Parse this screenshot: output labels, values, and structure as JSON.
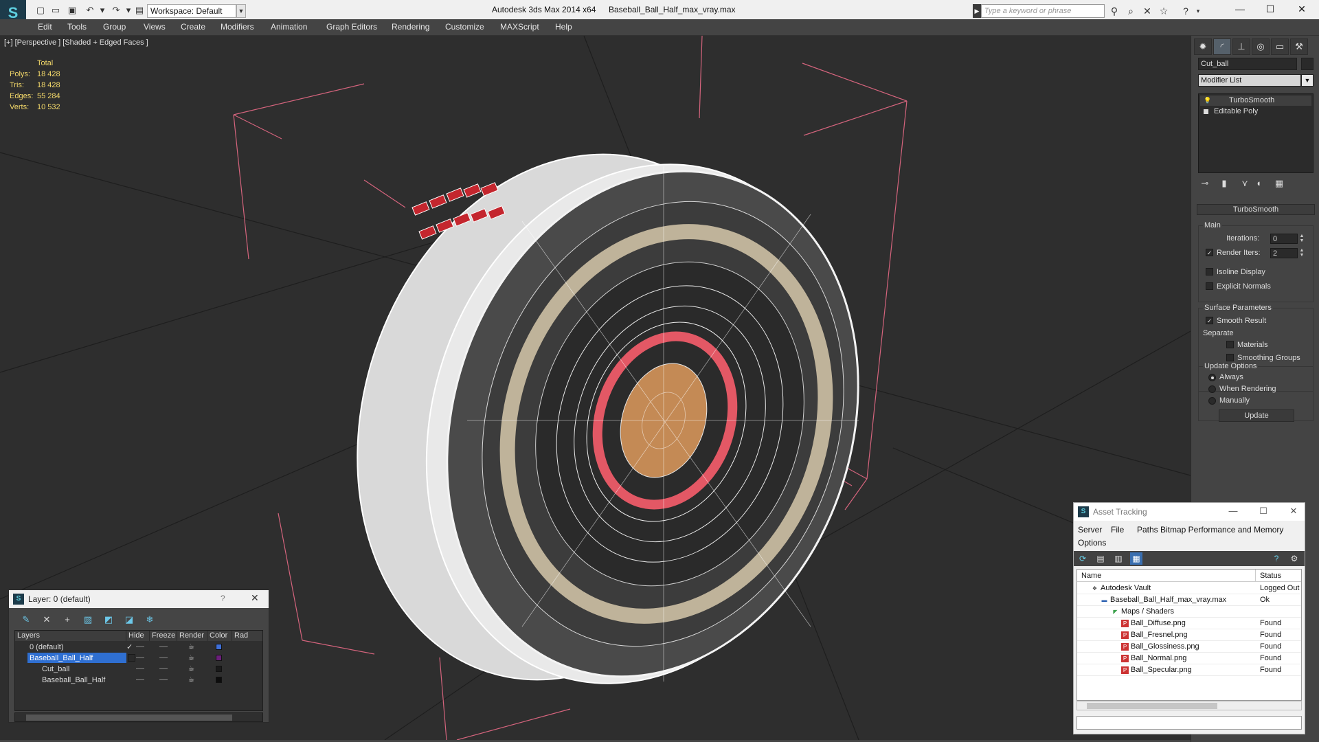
{
  "titlebar": {
    "app_title": "Autodesk 3ds Max  2014 x64",
    "file_title": "Baseball_Ball_Half_max_vray.max",
    "workspace": "Workspace: Default",
    "search_placeholder": "Type a keyword or phrase"
  },
  "menu": [
    "Edit",
    "Tools",
    "Group",
    "Views",
    "Create",
    "Modifiers",
    "Animation",
    "Graph Editors",
    "Rendering",
    "Customize",
    "MAXScript",
    "Help"
  ],
  "viewport": {
    "label": "[+] [Perspective ] [Shaded + Edged Faces ]",
    "stats": {
      "header": "Total",
      "polys_label": "Polys:",
      "polys": "18 428",
      "tris_label": "Tris:",
      "tris": "18 428",
      "edges_label": "Edges:",
      "edges": "55 284",
      "verts_label": "Verts:",
      "verts": "10 532"
    }
  },
  "command_panel": {
    "object_name": "Cut_ball",
    "modifier_list": "Modifier List",
    "stack": [
      "TurboSmooth",
      "Editable Poly"
    ],
    "rollout_title": "TurboSmooth",
    "main_group": "Main",
    "iterations_label": "Iterations:",
    "iterations_value": "0",
    "render_iters_label": "Render Iters:",
    "render_iters_value": "2",
    "isoline_label": "Isoline Display",
    "explicit_normals_label": "Explicit Normals",
    "surface_group": "Surface Parameters",
    "smooth_result_label": "Smooth Result",
    "separate_label": "Separate",
    "materials_label": "Materials",
    "smoothing_groups_label": "Smoothing Groups",
    "update_group": "Update Options",
    "always_label": "Always",
    "when_rendering_label": "When Rendering",
    "manually_label": "Manually",
    "update_button": "Update"
  },
  "layer_dialog": {
    "title": "Layer: 0 (default)",
    "help": "?",
    "columns": [
      "Layers",
      "Hide",
      "Freeze",
      "Render",
      "Color",
      "Rad"
    ],
    "rows": [
      {
        "name": "0 (default)",
        "color": "#3f6fd8"
      },
      {
        "name": "Baseball_Ball_Half",
        "color": "#6b1f7a"
      },
      {
        "name": "Cut_ball",
        "color": "#1a1a1a"
      },
      {
        "name": "Baseball_Ball_Half",
        "color": "#0d0d0d"
      }
    ]
  },
  "asset_dialog": {
    "title": "Asset Tracking",
    "menu": [
      "Server",
      "File",
      "Paths",
      "Bitmap Performance and Memory",
      "Options"
    ],
    "columns": [
      "Name",
      "Status"
    ],
    "rows": [
      {
        "name": "Autodesk Vault",
        "status": "Logged Out"
      },
      {
        "name": "Baseball_Ball_Half_max_vray.max",
        "status": "Ok"
      },
      {
        "name": "Maps / Shaders",
        "status": ""
      },
      {
        "name": "Ball_Diffuse.png",
        "status": "Found"
      },
      {
        "name": "Ball_Fresnel.png",
        "status": "Found"
      },
      {
        "name": "Ball_Glossiness.png",
        "status": "Found"
      },
      {
        "name": "Ball_Normal.png",
        "status": "Found"
      },
      {
        "name": "Ball_Specular.png",
        "status": "Found"
      }
    ]
  }
}
